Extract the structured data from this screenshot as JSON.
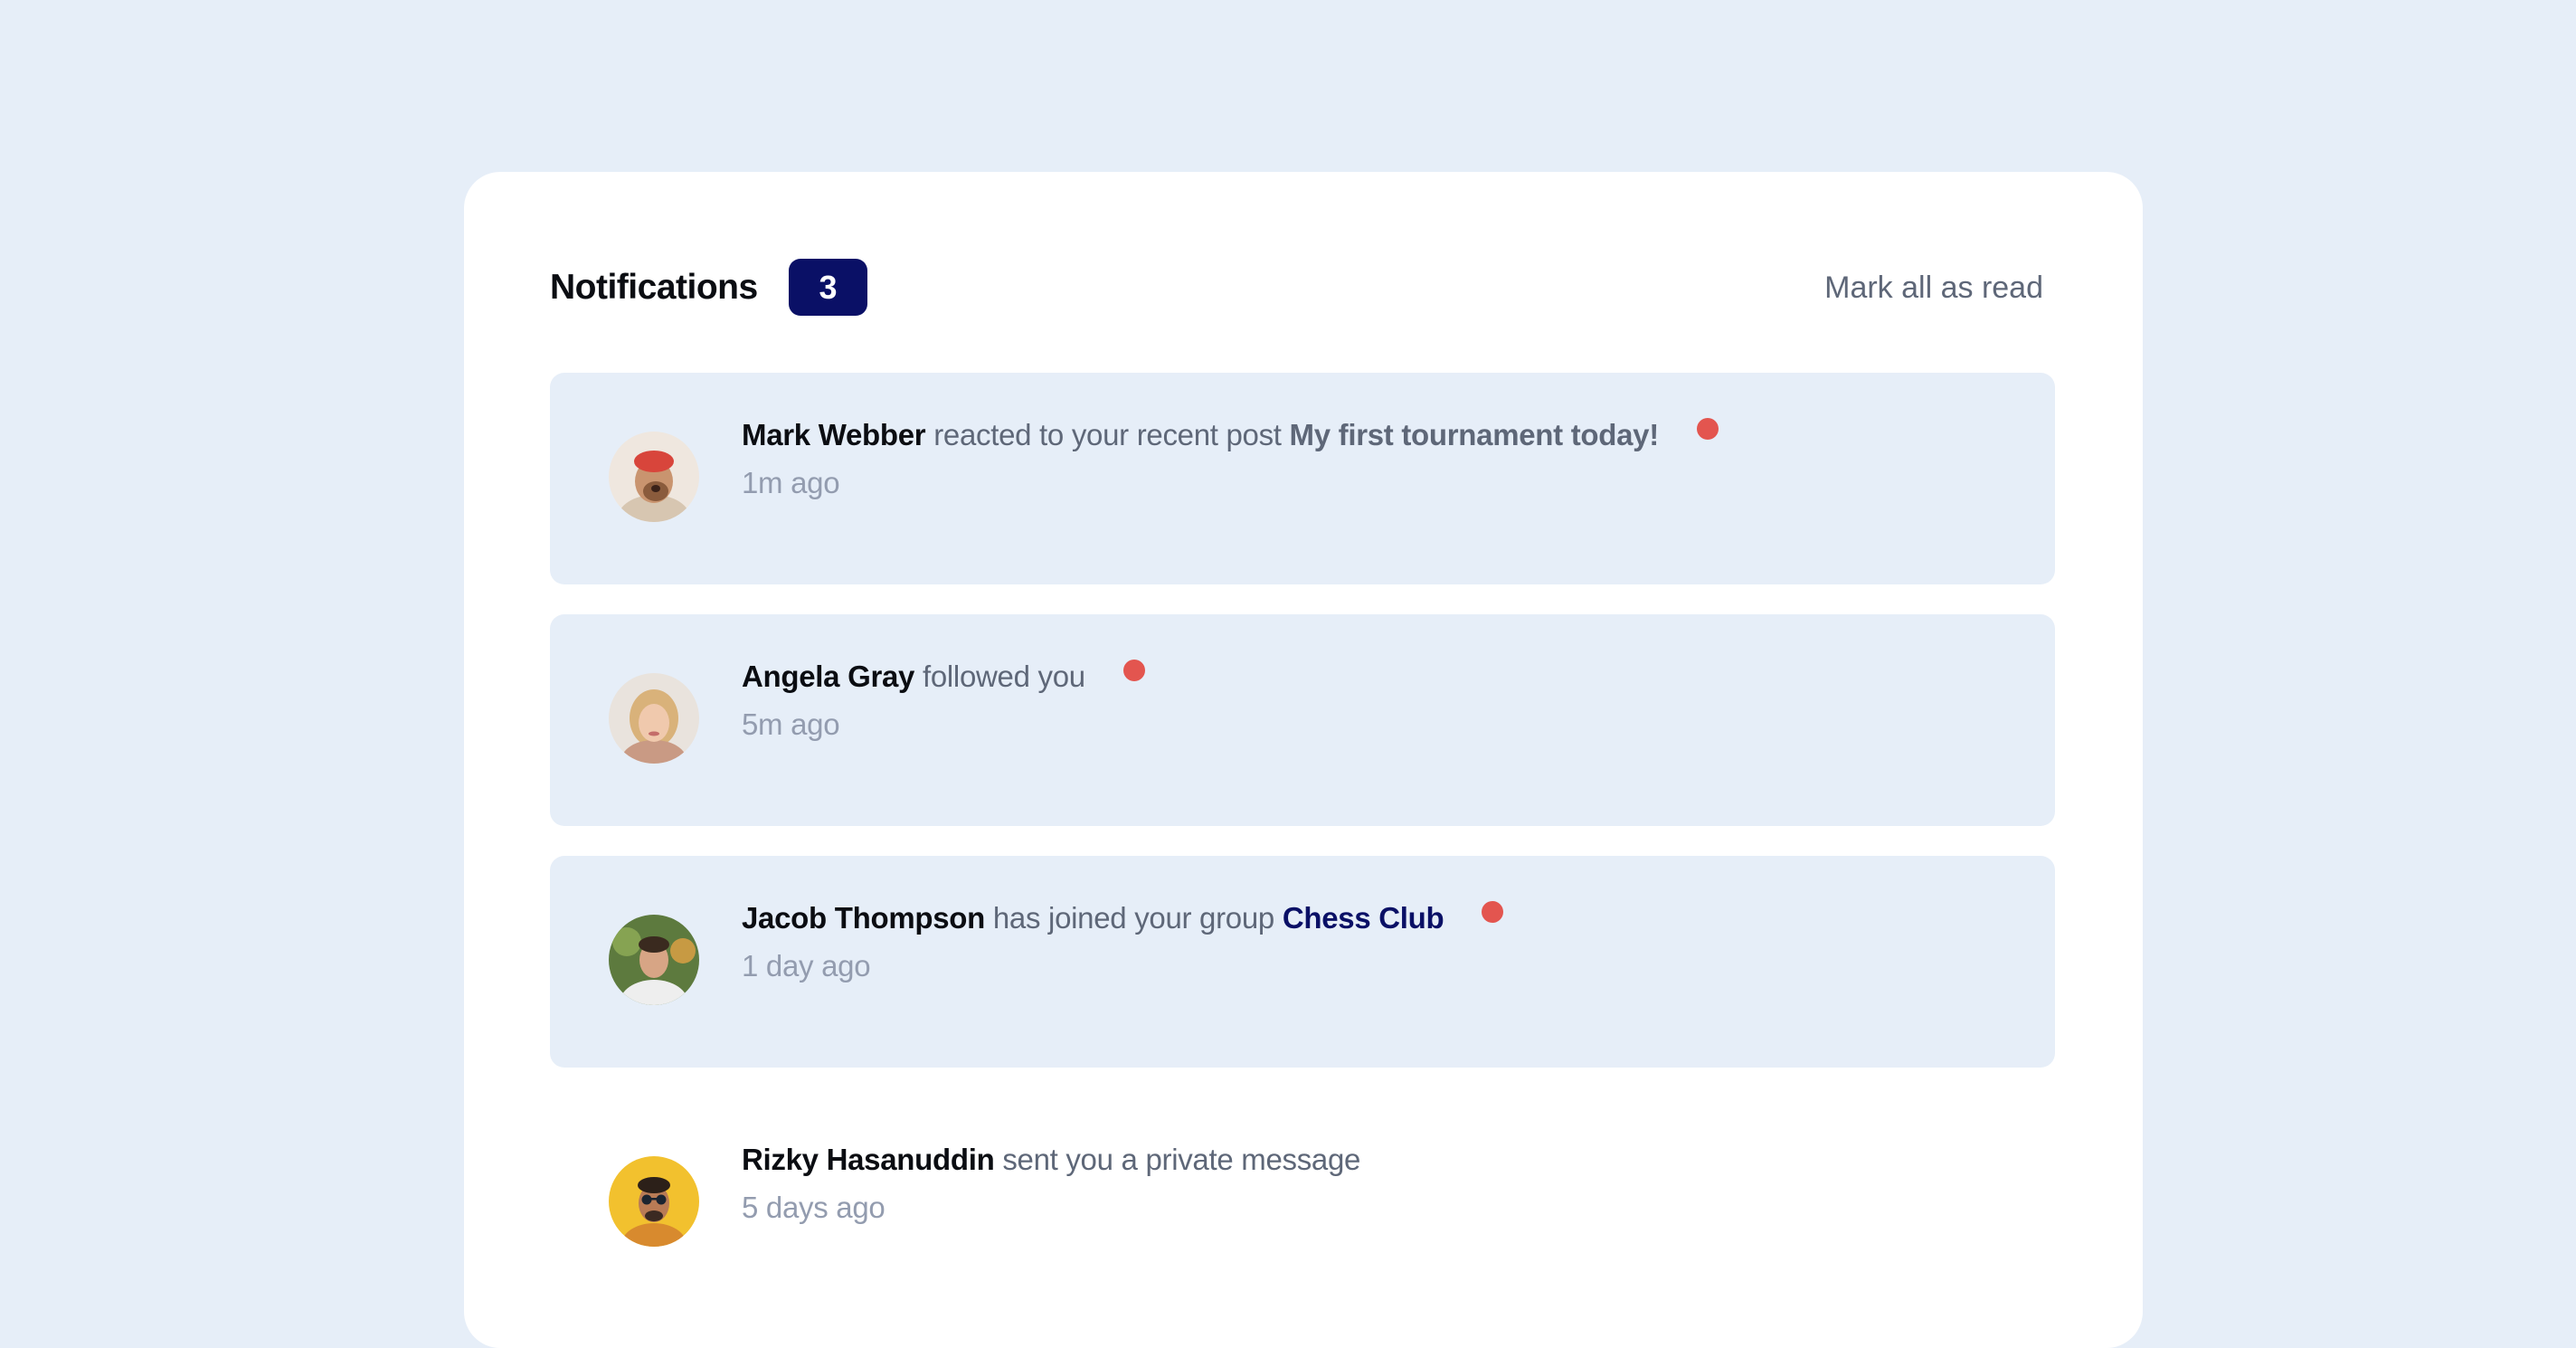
{
  "header": {
    "title": "Notifications",
    "unread_count": "3",
    "mark_all_label": "Mark all as read"
  },
  "colors": {
    "page_background": "#e6eef8",
    "card_background": "#ffffff",
    "unread_background": "#e6eef8",
    "badge_background": "#0a1066",
    "unread_dot": "#e3554f",
    "name_text": "#0b0d12",
    "body_text": "#5e6778",
    "time_text": "#939caf",
    "group_link": "#0a1066"
  },
  "notifications": [
    {
      "name": "Mark Webber",
      "action": "reacted to your recent post",
      "target": "My first tournament today!",
      "target_type": "post",
      "time": "1m ago",
      "unread": true,
      "avatar_icon": "avatar-mark-webber"
    },
    {
      "name": "Angela Gray",
      "action": "followed you",
      "target": "",
      "target_type": "none",
      "time": "5m ago",
      "unread": true,
      "avatar_icon": "avatar-angela-gray"
    },
    {
      "name": "Jacob Thompson",
      "action": "has joined your group",
      "target": "Chess Club",
      "target_type": "group",
      "time": "1 day ago",
      "unread": true,
      "avatar_icon": "avatar-jacob-thompson"
    },
    {
      "name": "Rizky Hasanuddin",
      "action": "sent you a private message",
      "target": "",
      "target_type": "none",
      "time": "5 days ago",
      "unread": false,
      "avatar_icon": "avatar-rizky-hasanuddin"
    }
  ]
}
